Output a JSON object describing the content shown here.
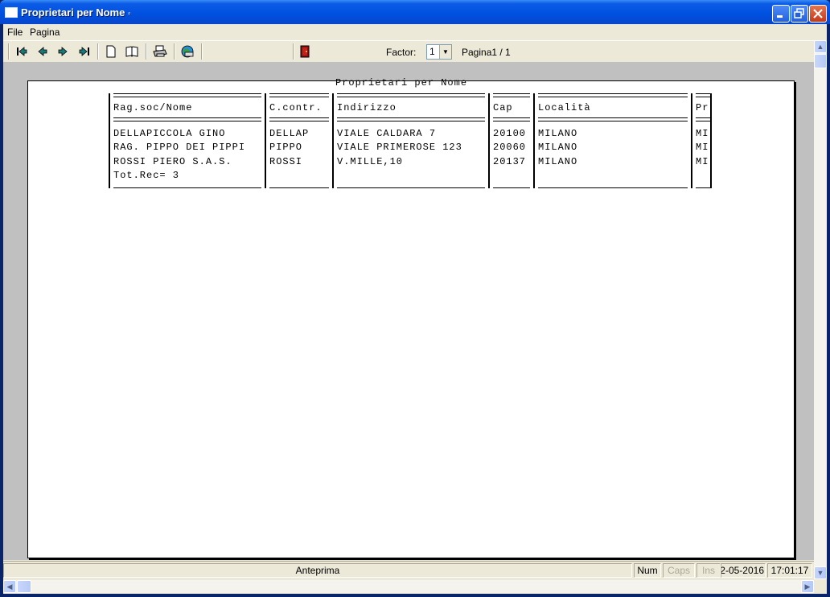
{
  "window": {
    "title": "Proprietari per Nome",
    "title_suffix": "▫"
  },
  "menu": {
    "items": [
      "File",
      "Pagina"
    ]
  },
  "toolbar": {
    "icons": [
      "first-page-icon",
      "prev-page-icon",
      "next-page-icon",
      "last-page-icon",
      "single-page-icon",
      "two-page-icon",
      "print-icon",
      "export-icon",
      "exit-icon"
    ],
    "factor_label": "Factor:",
    "factor_value": "1",
    "page_label": "Pagina1 / 1"
  },
  "report": {
    "title": "Proprietari per Nome",
    "columns": [
      "Rag.soc/Nome",
      "C.contr.",
      "Indirizzo",
      "Cap",
      "Località",
      "Pr"
    ],
    "rows": [
      [
        "DELLAPICCOLA GINO",
        "DELLAP",
        "VIALE CALDARA 7",
        "20100",
        "MILANO",
        "MI"
      ],
      [
        "RAG. PIPPO DEI PIPPI",
        "PIPPO",
        "VIALE PRIMEROSE 123",
        "20060",
        "MILANO",
        "MI"
      ],
      [
        "ROSSI PIERO S.A.S.",
        "ROSSI",
        "V.MILLE,10",
        "20137",
        "MILANO",
        "MI"
      ]
    ],
    "total": "Tot.Rec= 3"
  },
  "statusbar": {
    "mode": "Anteprima",
    "num": "Num",
    "caps": "Caps",
    "ins": "Ins",
    "date": "02-05-2016",
    "time": "17:01:17"
  },
  "colors": {
    "titlebar": "#0050e0",
    "face": "#ece9d8",
    "preview_bg": "#c0c0c0"
  }
}
